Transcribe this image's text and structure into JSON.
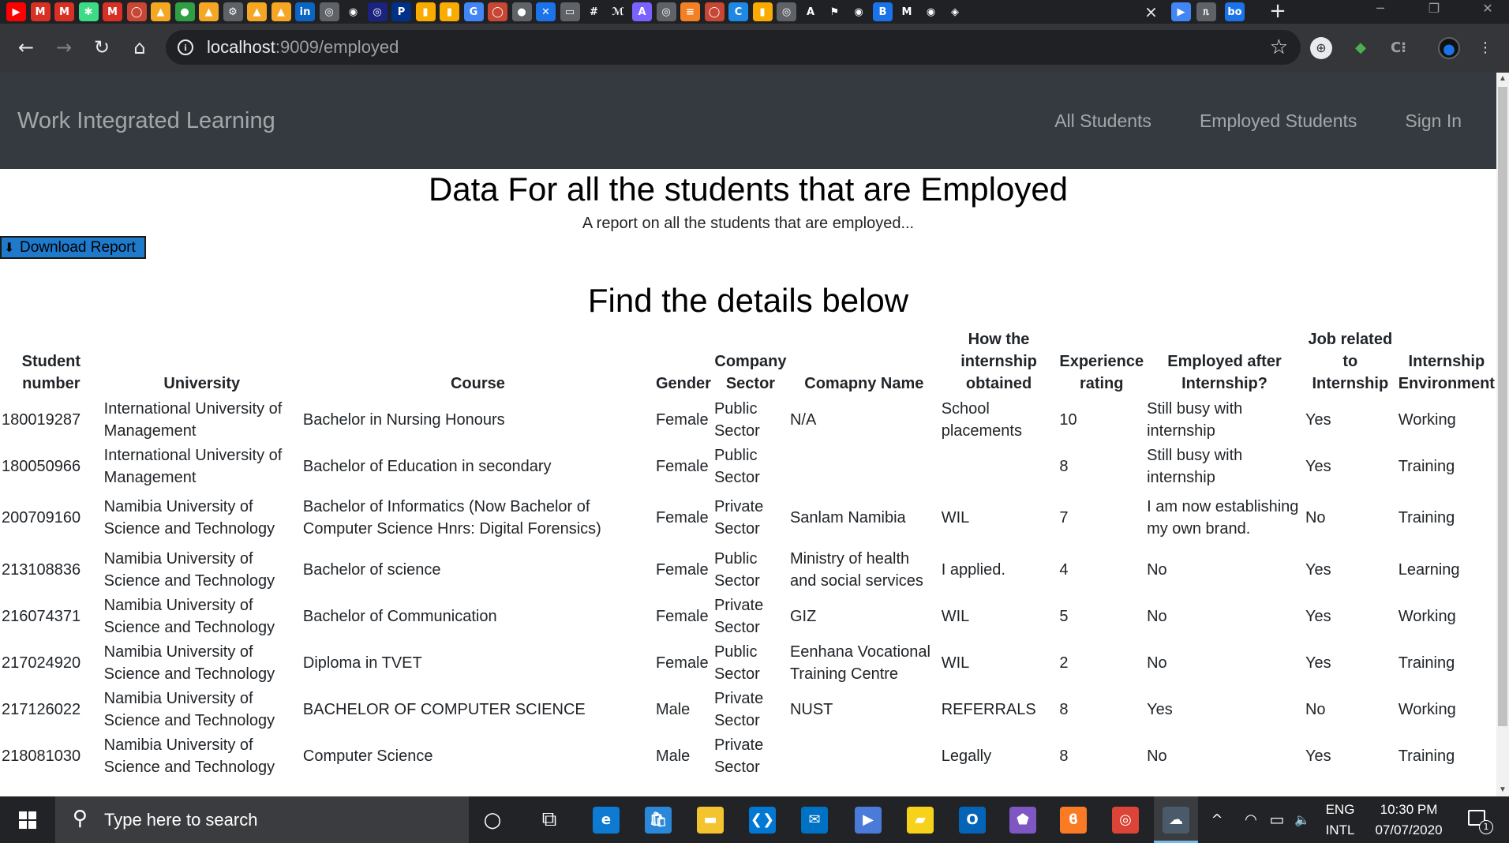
{
  "browser": {
    "tab_icons": [
      {
        "icon": "youtube-icon",
        "glyph": "▶",
        "color": "#ff0000"
      },
      {
        "icon": "gmail-icon",
        "glyph": "M",
        "color": "#d93025"
      },
      {
        "icon": "gmail-icon",
        "glyph": "M",
        "color": "#d93025"
      },
      {
        "icon": "android-icon",
        "glyph": "✱",
        "color": "#3ddc84"
      },
      {
        "icon": "gmail-icon",
        "glyph": "M",
        "color": "#d93025"
      },
      {
        "icon": "oracle-icon",
        "glyph": "◯",
        "color": "#c74634"
      },
      {
        "icon": "firebase-icon",
        "glyph": "▲",
        "color": "#f5a623"
      },
      {
        "icon": "green-circle-icon",
        "glyph": "●",
        "color": "#2ea043"
      },
      {
        "icon": "firebase-icon",
        "glyph": "▲",
        "color": "#f5a623"
      },
      {
        "icon": "gear-icon",
        "glyph": "⚙",
        "color": "#5f6368"
      },
      {
        "icon": "firebase-icon",
        "glyph": "▲",
        "color": "#f5a623"
      },
      {
        "icon": "firebase-icon",
        "glyph": "▲",
        "color": "#f5a623"
      },
      {
        "icon": "linkedin-icon",
        "glyph": "in",
        "color": "#0a66c2"
      },
      {
        "icon": "globe-icon",
        "glyph": "◎",
        "color": "#5f6368"
      },
      {
        "icon": "github-icon",
        "glyph": "◉",
        "color": "#ffffff"
      },
      {
        "icon": "globe-icon",
        "glyph": "◎",
        "color": "#1a237e"
      },
      {
        "icon": "paypal-icon",
        "glyph": "P",
        "color": "#003087"
      },
      {
        "icon": "analytics-icon",
        "glyph": "▮",
        "color": "#f9ab00"
      },
      {
        "icon": "analytics-icon",
        "glyph": "▮",
        "color": "#f9ab00"
      },
      {
        "icon": "google-icon",
        "glyph": "G",
        "color": "#4285f4"
      },
      {
        "icon": "oracle-icon",
        "glyph": "◯",
        "color": "#c74634"
      },
      {
        "icon": "apple-icon",
        "glyph": "●",
        "color": "#5f6368"
      },
      {
        "icon": "x-box-icon",
        "glyph": "✕",
        "color": "#1a73e8"
      },
      {
        "icon": "window-icon",
        "glyph": "▭",
        "color": "#5f6368"
      },
      {
        "icon": "grid-icon",
        "glyph": "#",
        "color": "#303134"
      },
      {
        "icon": "script-icon",
        "glyph": "ℳ",
        "color": "#303134"
      },
      {
        "icon": "azure-icon",
        "glyph": "A",
        "color": "#7b61ff"
      },
      {
        "icon": "globe-icon",
        "glyph": "◎",
        "color": "#5f6368"
      },
      {
        "icon": "stackoverflow-icon",
        "glyph": "≡",
        "color": "#f48024"
      },
      {
        "icon": "oracle-icon",
        "glyph": "◯",
        "color": "#c74634"
      },
      {
        "icon": "c-icon",
        "glyph": "C",
        "color": "#1e88e5"
      },
      {
        "icon": "analytics-icon",
        "glyph": "▮",
        "color": "#f9ab00"
      },
      {
        "icon": "globe-icon",
        "glyph": "◎",
        "color": "#5f6368"
      },
      {
        "icon": "a-icon",
        "glyph": "A",
        "color": "#ffffff"
      },
      {
        "icon": "flag-icon",
        "glyph": "⚑",
        "color": "#ffffff"
      },
      {
        "icon": "github-icon",
        "glyph": "◉",
        "color": "#ffffff"
      },
      {
        "icon": "b-icon",
        "glyph": "B",
        "color": "#1a73e8"
      },
      {
        "icon": "medium-icon",
        "glyph": "M",
        "color": "#ffffff"
      },
      {
        "icon": "github-icon",
        "glyph": "◉",
        "color": "#ffffff"
      },
      {
        "icon": "compass-icon",
        "glyph": "◈",
        "color": "#ffffff"
      }
    ],
    "tab_close": "×",
    "tab_icons_right": [
      {
        "icon": "play-icon",
        "glyph": "▶",
        "color": "#4285f4"
      },
      {
        "icon": "letters-icon",
        "glyph": "ᥰ",
        "color": "#5f6368"
      },
      {
        "icon": "bo-icon",
        "glyph": "bo",
        "color": "#1a73e8"
      }
    ],
    "new_tab": "+",
    "window_min": "─",
    "window_restore": "❐",
    "window_close": "✕",
    "url_host": "localhost",
    "url_path": ":9009/employed",
    "nav_back": "←",
    "nav_forward": "→",
    "nav_reload": "↻",
    "nav_home": "⌂"
  },
  "navbar": {
    "brand": "Work Integrated Learning",
    "links": [
      "All Students",
      "Employed Students",
      "Sign In"
    ]
  },
  "page": {
    "title": "Data For all the students that are Employed",
    "subtitle": "A report on all the students that are employed...",
    "download_label": "Download Report",
    "section_title": "Find the details below"
  },
  "table": {
    "headers": [
      "Student number",
      "University",
      "Course",
      "Gender",
      "Company Sector",
      "Comapny Name",
      "How the internship obtained",
      "Experience rating",
      "Employed after Internship?",
      "Job related to Internship",
      "Internship Environment"
    ],
    "rows": [
      [
        "180019287",
        "International University of Management",
        "Bachelor in Nursing Honours",
        "Female",
        "Public Sector",
        "N/A",
        "School placements",
        "10",
        "Still busy with internship",
        "Yes",
        "Working"
      ],
      [
        "180050966",
        "International University of Management",
        "Bachelor of Education in secondary",
        "Female",
        "Public Sector",
        "",
        "",
        "8",
        "Still busy with internship",
        "Yes",
        "Training"
      ],
      [
        "200709160",
        "Namibia University of Science and Technology",
        "Bachelor of Informatics (Now Bachelor of Computer Science Hnrs: Digital Forensics)",
        "Female",
        "Private Sector",
        "Sanlam Namibia",
        "WIL",
        "7",
        "I am now establishing my own brand.",
        "No",
        "Training"
      ],
      [
        "213108836",
        "Namibia University of Science and Technology",
        "Bachelor of science",
        "Female",
        "Public Sector",
        "Ministry of health and social services",
        "I applied.",
        "4",
        "No",
        "Yes",
        "Learning"
      ],
      [
        "216074371",
        "Namibia University of Science and Technology",
        "Bachelor of Communication",
        "Female",
        "Private Sector",
        "GIZ",
        "WIL",
        "5",
        "No",
        "Yes",
        "Working"
      ],
      [
        "217024920",
        "Namibia University of Science and Technology",
        "Diploma in TVET",
        "Female",
        "Public Sector",
        "Eenhana Vocational Training Centre",
        "WIL",
        "2",
        "No",
        "Yes",
        "Training"
      ],
      [
        "217126022",
        "Namibia University of Science and Technology",
        "BACHELOR OF COMPUTER SCIENCE",
        "Male",
        "Private Sector",
        "NUST",
        "REFERRALS",
        "8",
        "Yes",
        "No",
        "Working"
      ],
      [
        "218081030",
        "Namibia University of Science and Technology",
        "Computer Science",
        "Male",
        "Private Sector",
        "",
        "Legally",
        "8",
        "No",
        "Yes",
        "Training"
      ]
    ]
  },
  "taskbar": {
    "search_placeholder": "Type here to search",
    "apps": [
      {
        "icon": "cortana-icon",
        "glyph": "○",
        "color": "transparent"
      },
      {
        "icon": "task-view-icon",
        "glyph": "⧉",
        "color": "transparent"
      },
      {
        "icon": "edge-icon",
        "glyph": "e",
        "color": "#0c7bd1"
      },
      {
        "icon": "store-icon",
        "glyph": "🛍",
        "color": "#2b88d8"
      },
      {
        "icon": "file-explorer-icon",
        "glyph": "▬",
        "color": "#f4c430"
      },
      {
        "icon": "vscode-icon",
        "glyph": "❮❯",
        "color": "#0078d4"
      },
      {
        "icon": "mail-icon",
        "glyph": "✉",
        "color": "#0072c6"
      },
      {
        "icon": "media-icon",
        "glyph": "▶",
        "color": "#4b7bd8"
      },
      {
        "icon": "sticky-notes-icon",
        "glyph": "▰",
        "color": "#f7d21b"
      },
      {
        "icon": "outlook-icon",
        "glyph": "O",
        "color": "#0364b8"
      },
      {
        "icon": "pentagon-app-icon",
        "glyph": "⬟",
        "color": "#7e57c2"
      },
      {
        "icon": "xampp-icon",
        "glyph": "ϐ",
        "color": "#fb7a24"
      },
      {
        "icon": "chrome-icon",
        "glyph": "◎",
        "color": "#db4437"
      },
      {
        "icon": "cloud-app-icon",
        "glyph": "☁",
        "color": "#4a5a6a"
      }
    ],
    "tray_chevron": "^",
    "tray_network": "◠",
    "tray_battery": "▭",
    "tray_volume": "🔈",
    "lang_top": "ENG",
    "lang_bottom": "INTL",
    "time": "10:30 PM",
    "date": "07/07/2020",
    "notification_count": "1"
  }
}
